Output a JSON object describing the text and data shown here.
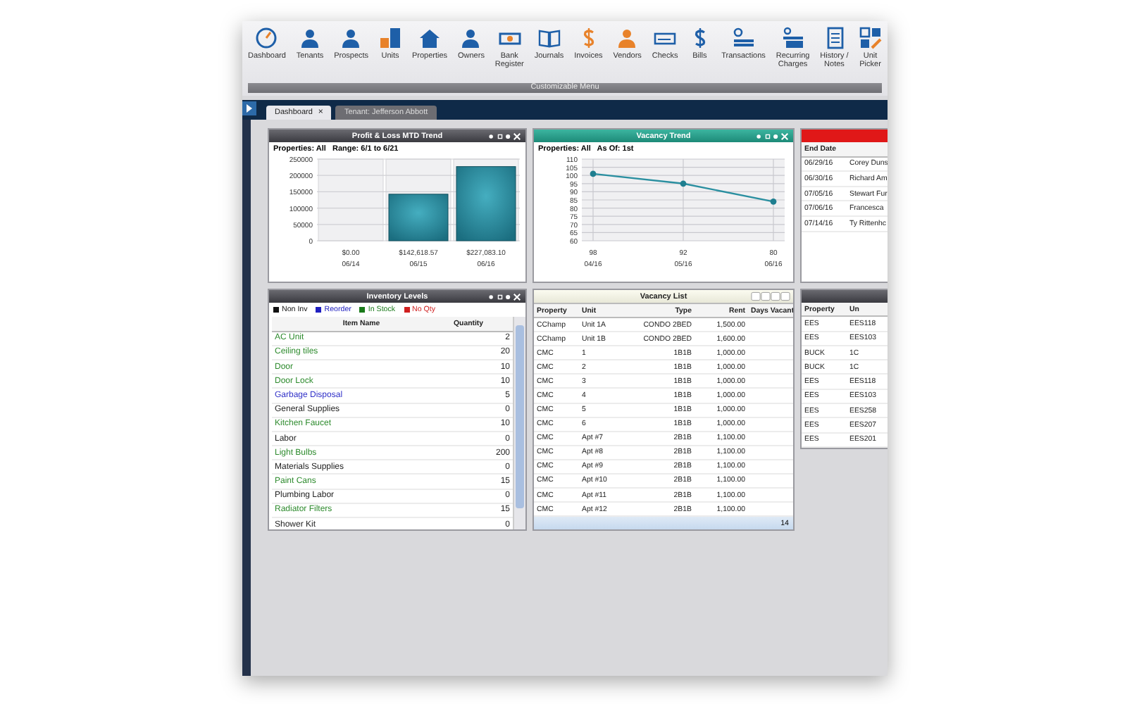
{
  "toolbar": {
    "items": [
      {
        "label": "Dashboard"
      },
      {
        "label": "Tenants"
      },
      {
        "label": "Prospects"
      },
      {
        "label": "Units"
      },
      {
        "label": "Properties"
      },
      {
        "label": "Owners"
      },
      {
        "label": "Bank\nRegister"
      },
      {
        "label": "Journals"
      },
      {
        "label": "Invoices"
      },
      {
        "label": "Vendors"
      },
      {
        "label": "Checks"
      },
      {
        "label": "Bills"
      },
      {
        "label": "Transactions"
      },
      {
        "label": "Recurring\nCharges"
      },
      {
        "label": "History /\nNotes"
      },
      {
        "label": "Unit\nPicker"
      }
    ],
    "caption": "Customizable Menu"
  },
  "tabs": [
    {
      "label": "Dashboard",
      "selected": true,
      "close": "×"
    },
    {
      "label": "Tenant: Jefferson Abbott",
      "selected": false
    }
  ],
  "pl_trend": {
    "title": "Profit & Loss MTD Trend",
    "subtitle": "Properties: All   Range: 6/1 to 6/21",
    "chart_data": {
      "type": "bar",
      "categories": [
        "06/14",
        "06/15",
        "06/16"
      ],
      "values": [
        0,
        142618.57,
        227083.1
      ],
      "value_labels": [
        "$0.00",
        "$142,618.57",
        "$227,083.10"
      ],
      "grid": true,
      "ylim": [
        0,
        250000
      ],
      "yticks": [
        0,
        50000,
        100000,
        150000,
        200000,
        250000
      ]
    }
  },
  "vacancy_trend": {
    "title": "Vacancy Trend",
    "subtitle": "Properties: All   As Of: 1st",
    "point_labels": [
      "98",
      "92",
      "80"
    ],
    "chart_data": {
      "type": "line",
      "categories": [
        "04/16",
        "05/16",
        "06/16"
      ],
      "values": [
        101,
        95,
        84
      ],
      "marker": "circle",
      "grid": true,
      "ylim": [
        60,
        110
      ],
      "yticks": [
        60,
        65,
        70,
        75,
        80,
        85,
        90,
        95,
        100,
        105,
        110
      ]
    }
  },
  "lease_panel": {
    "columns": [
      "End Date"
    ],
    "rows": [
      [
        "06/29/16",
        "Corey Duns"
      ],
      [
        "06/30/16",
        "Richard Am"
      ],
      [
        "07/05/16",
        "Stewart Fur"
      ],
      [
        "07/06/16",
        "Francesca"
      ],
      [
        "07/14/16",
        "Ty Rittenhc"
      ]
    ]
  },
  "inventory": {
    "title": "Inventory Levels",
    "legend": [
      {
        "label": "Non Inv",
        "color": "#111111"
      },
      {
        "label": "Reorder",
        "color": "#2020c0"
      },
      {
        "label": "In Stock",
        "color": "#1a7a1a"
      },
      {
        "label": "No Qty",
        "color": "#d02020"
      }
    ],
    "columns": [
      "Item Name",
      "Quantity"
    ],
    "rows": [
      {
        "name": "AC Unit",
        "quantity": "2",
        "color": "#2e8b2e"
      },
      {
        "name": "Ceiling tiles",
        "quantity": "20",
        "color": "#2e8b2e"
      },
      {
        "name": "Door",
        "quantity": "10",
        "color": "#2e8b2e"
      },
      {
        "name": "Door Lock",
        "quantity": "10",
        "color": "#2e8b2e"
      },
      {
        "name": "Garbage Disposal",
        "quantity": "5",
        "color": "#3030c8"
      },
      {
        "name": "General Supplies",
        "quantity": "0",
        "color": "#222222"
      },
      {
        "name": "Kitchen Faucet",
        "quantity": "10",
        "color": "#2e8b2e"
      },
      {
        "name": "Labor",
        "quantity": "0",
        "color": "#222222"
      },
      {
        "name": "Light Bulbs",
        "quantity": "200",
        "color": "#2e8b2e"
      },
      {
        "name": "Materials Supplies",
        "quantity": "0",
        "color": "#222222"
      },
      {
        "name": "Paint Cans",
        "quantity": "15",
        "color": "#2e8b2e"
      },
      {
        "name": "Plumbing Labor",
        "quantity": "0",
        "color": "#222222"
      },
      {
        "name": "Radiator Filters",
        "quantity": "15",
        "color": "#2e8b2e"
      },
      {
        "name": "Shower Kit",
        "quantity": "0",
        "color": "#222222"
      }
    ]
  },
  "vacancy_list": {
    "title": "Vacancy List",
    "columns": [
      "Property",
      "Unit",
      "Type",
      "Rent",
      "Days Vacant"
    ],
    "rows": [
      [
        "CChamp",
        "Unit 1A",
        "CONDO 2BED",
        "1,500.00"
      ],
      [
        "CChamp",
        "Unit 1B",
        "CONDO 2BED",
        "1,600.00"
      ],
      [
        "CMC",
        "1",
        "1B1B",
        "1,000.00"
      ],
      [
        "CMC",
        "2",
        "1B1B",
        "1,000.00"
      ],
      [
        "CMC",
        "3",
        "1B1B",
        "1,000.00"
      ],
      [
        "CMC",
        "4",
        "1B1B",
        "1,000.00"
      ],
      [
        "CMC",
        "5",
        "1B1B",
        "1,000.00"
      ],
      [
        "CMC",
        "6",
        "1B1B",
        "1,000.00"
      ],
      [
        "CMC",
        "Apt #7",
        "2B1B",
        "1,100.00"
      ],
      [
        "CMC",
        "Apt #8",
        "2B1B",
        "1,100.00"
      ],
      [
        "CMC",
        "Apt #9",
        "2B1B",
        "1,100.00"
      ],
      [
        "CMC",
        "Apt #10",
        "2B1B",
        "1,100.00"
      ],
      [
        "CMC",
        "Apt #11",
        "2B1B",
        "1,100.00"
      ],
      [
        "CMC",
        "Apt #12",
        "2B1B",
        "1,100.00"
      ]
    ],
    "footer": "14"
  },
  "units_panel": {
    "columns": [
      "Property",
      "Un"
    ],
    "rows": [
      [
        "EES",
        "EES118"
      ],
      [
        "EES",
        "EES103"
      ],
      [
        "BUCK",
        "1C"
      ],
      [
        "BUCK",
        "1C"
      ],
      [
        "EES",
        "EES118"
      ],
      [
        "EES",
        "EES103"
      ],
      [
        "EES",
        "EES258"
      ],
      [
        "EES",
        "EES207"
      ],
      [
        "EES",
        "EES201"
      ]
    ]
  }
}
